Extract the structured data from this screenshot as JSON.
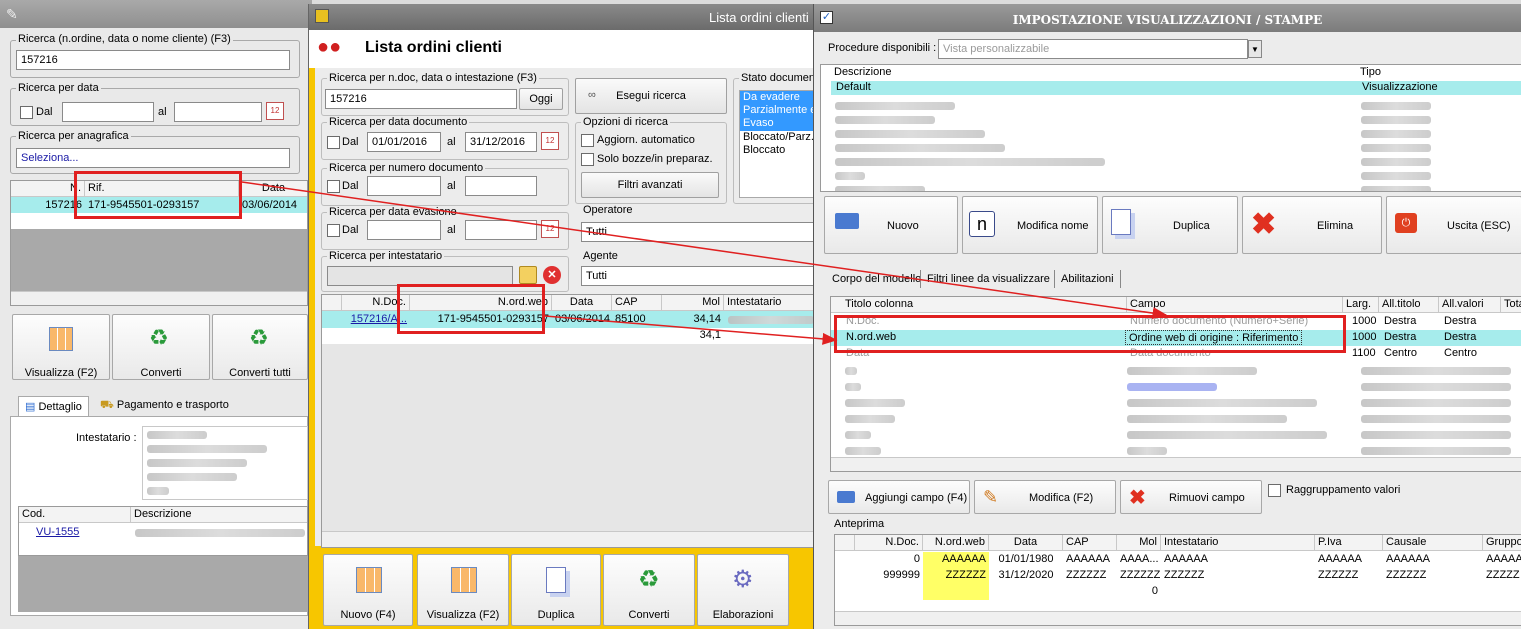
{
  "left_window": {
    "search_label": "Ricerca (n.ordine, data o nome cliente) (F3)",
    "search_value": "157216",
    "date_label": "Ricerca per data",
    "dal_label": "Dal",
    "al_label": "al",
    "anagrafica_label": "Ricerca per anagrafica",
    "seleziona": "Seleziona...",
    "grid_headers": [
      "N.",
      "Rif.",
      "Data"
    ],
    "grid_row": [
      "157216",
      "171-9545501-0293157",
      "03/06/2014"
    ],
    "btn_visualizza": "Visualizza (F2)",
    "btn_converti": "Converti",
    "btn_converti_tutti": "Converti tutti",
    "tab_dettaglio": "Dettaglio",
    "tab_pagamento": "Pagamento e trasporto",
    "intestatario_label": "Intestatario :",
    "cod_header": "Cod.",
    "descrizione_header": "Descrizione",
    "cod_value": "VU-1555"
  },
  "middle_window": {
    "titlebar_text": "Lista ordini clienti",
    "title": "Lista ordini clienti",
    "search_label": "Ricerca per n.doc, data o intestazione (F3)",
    "search_value": "157216",
    "oggi": "Oggi",
    "esegui": "Esegui ricerca",
    "stato_label": "Stato documento",
    "stato_items": [
      "Da evadere",
      "Parzialmente ev.",
      "Evaso",
      "Bloccato/Parz.e",
      "Bloccato"
    ],
    "data_doc_label": "Ricerca per data documento",
    "dal_label": "Dal",
    "al_label": "al",
    "date_from": "01/01/2016",
    "date_to": "31/12/2016",
    "opzioni_label": "Opzioni di ricerca",
    "aggiorn": "Aggiorn. automatico",
    "bozze": "Solo bozze/in preparaz.",
    "filtri": "Filtri avanzati",
    "numero_label": "Ricerca per numero documento",
    "operatore_label": "Operatore",
    "operatore_value": "Tutti",
    "evasione_label": "Ricerca per data evasione",
    "intestatario_label": "Ricerca per intestatario",
    "agente_label": "Agente",
    "agente_value": "Tutti",
    "grid_headers": [
      "N.Doc.",
      "N.ord.web",
      "Data",
      "CAP",
      "Mol",
      "Intestatario"
    ],
    "row1": [
      "157216/A...",
      "171-9545501-0293157",
      "03/06/2014",
      "85100",
      "34,14"
    ],
    "row2_mol": "34,1",
    "btn_nuovo": "Nuovo (F4)",
    "btn_visualizza": "Visualizza (F2)",
    "btn_duplica": "Duplica",
    "btn_converti": "Converti",
    "btn_elaborazioni": "Elaborazioni"
  },
  "right_window": {
    "title": "IMPOSTAZIONE VISUALIZZAZIONI / STAMPE",
    "procedure_label": "Procedure disponibili :",
    "procedure_value": "Vista personalizzabile",
    "list_headers": [
      "Descrizione",
      "Tipo"
    ],
    "list_first": [
      "Default",
      "Visualizzazione"
    ],
    "btn_nuovo": "Nuovo",
    "btn_modifica_nome": "Modifica nome",
    "btn_duplica": "Duplica",
    "btn_elimina": "Elimina",
    "btn_uscita": "Uscita (ESC)",
    "tabs": [
      "Corpo del modello",
      "Filtri linee da visualizzare",
      "Abilitazioni"
    ],
    "col_headers": [
      "Titolo colonna",
      "Campo",
      "Larg.",
      "All.titolo",
      "All.valori",
      "Tota"
    ],
    "col_rows": [
      [
        "N.Doc.",
        "Numero documento (Numero+Serie)",
        "1000",
        "Destra",
        "Destra"
      ],
      [
        "N.ord.web",
        "Ordine web di origine : Riferimento",
        "1000",
        "Destra",
        "Destra"
      ],
      [
        "Data",
        "Data documento",
        "1100",
        "Centro",
        "Centro"
      ]
    ],
    "btn_aggiungi": "Aggiungi campo (F4)",
    "btn_modifica": "Modifica (F2)",
    "btn_rimuovi": "Rimuovi campo",
    "raggruppamento": "Raggruppamento valori",
    "anteprima_label": "Anteprima",
    "prev_headers": [
      "N.Doc.",
      "N.ord.web",
      "Data",
      "CAP",
      "Mol",
      "Intestatario",
      "P.Iva",
      "Causale",
      "Gruppo"
    ],
    "prev_row1": [
      "0",
      "AAAAAA",
      "01/01/1980",
      "AAAAAA",
      "AAAA...",
      "AAAAAA",
      "AAAAAA",
      "AAAAAA",
      "AAAAA"
    ],
    "prev_row2": [
      "999999",
      "ZZZZZZ",
      "31/12/2020",
      "ZZZZZZ",
      "ZZZZZZ",
      "ZZZZZZ",
      "ZZZZZZ",
      "ZZZZZZ",
      "ZZZZZ"
    ],
    "prev_row3_mol": "0"
  },
  "colors": {
    "highlight": "#a6ecec",
    "yellow_frame": "#f7c600",
    "annotation_red": "#e02020",
    "preview_yellow": "#ffff66"
  }
}
